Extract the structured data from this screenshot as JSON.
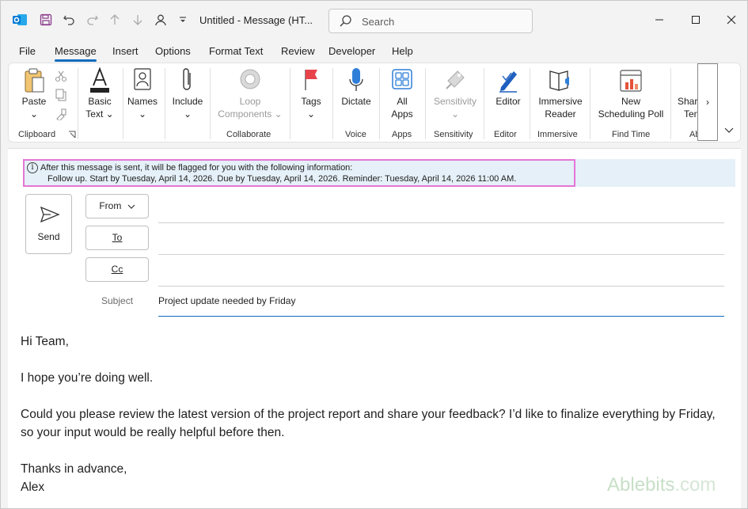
{
  "titlebar": {
    "title": "Untitled - Message (HT...",
    "search_placeholder": "Search"
  },
  "menu": {
    "tabs": [
      "File",
      "Message",
      "Insert",
      "Options",
      "Format Text",
      "Review",
      "Developer",
      "Help"
    ],
    "active": "Message"
  },
  "ribbon": {
    "paste": "Paste",
    "clipboard_group": "Clipboard",
    "basic_text_1": "Basic",
    "basic_text_2": "Text",
    "names": "Names",
    "include": "Include",
    "loop_1": "Loop",
    "loop_2": "Components",
    "collaborate_group": "Collaborate",
    "tags": "Tags",
    "dictate": "Dictate",
    "voice_group": "Voice",
    "all_apps_1": "All",
    "all_apps_2": "Apps",
    "apps_group": "Apps",
    "sensitivity": "Sensitivity",
    "sensitivity_group": "Sensitivity",
    "editor": "Editor",
    "editor_group": "Editor",
    "immersive_1": "Immersive",
    "immersive_2": "Reader",
    "immersive_group": "Immersive",
    "new_1": "New",
    "new_2": "Scheduling Poll",
    "findtime_group": "Find Time",
    "share_1": "Share",
    "share_2": "Ten",
    "ab_group": "Ab"
  },
  "infobar": {
    "line1": "After this message is sent, it will be flagged for you with the following information:",
    "line2": "Follow up.  Start by Tuesday, April 14, 2026.  Due by Tuesday, April 14, 2026.  Reminder: Tuesday, April 14, 2026 11:00 AM."
  },
  "compose": {
    "send": "Send",
    "from": "From",
    "to": "To",
    "cc": "Cc",
    "subject_label": "Subject",
    "subject_value": "Project update needed by Friday"
  },
  "body": {
    "greeting": "Hi Team,",
    "line1": "I hope you’re doing well.",
    "line2": "Could you please review the latest version of the project report and share your feedback? I’d like to finalize everything by Friday, so your input would be really helpful before then.",
    "closing": "Thanks in advance,",
    "signature": "Alex"
  },
  "watermark": {
    "brand": "Ablebits",
    "suffix": ".com"
  },
  "colors": {
    "accent": "#0f6cbd",
    "highlight": "#e576d6",
    "infobar_bg": "#e5f0f8"
  }
}
